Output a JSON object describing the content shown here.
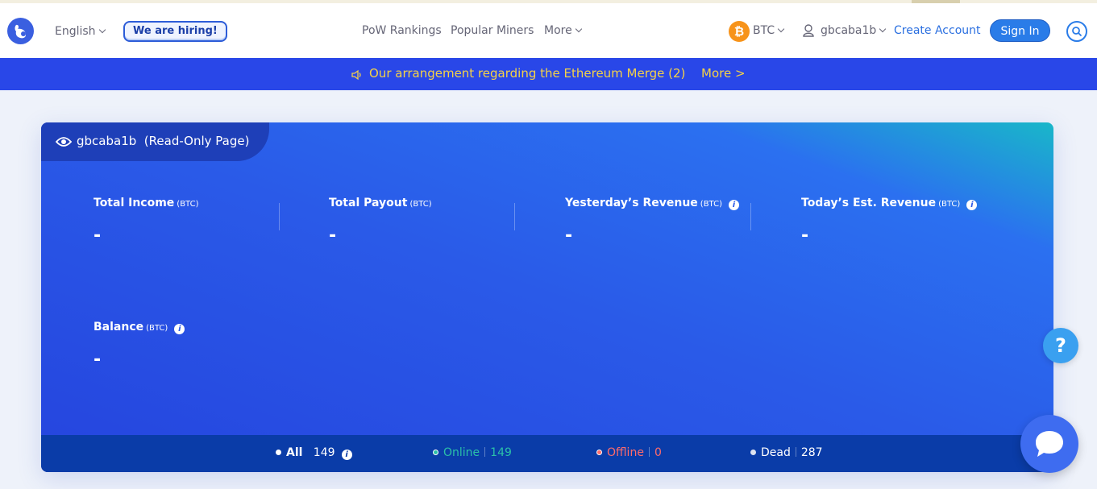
{
  "header": {
    "language": "English",
    "hiring": "We are hiring!",
    "nav": [
      "PoW Rankings",
      "Popular Miners",
      "More"
    ],
    "coin": "BTC",
    "username": "gbcaba1b",
    "create_account": "Create Account",
    "sign_in": "Sign In"
  },
  "banner": {
    "text": "Our arrangement regarding the Ethereum Merge (2)",
    "more": "More >"
  },
  "card": {
    "title": "gbcaba1b  (Read-Only Page)",
    "stats": [
      {
        "label": "Total Income",
        "unit": "(BTC)",
        "value": "-"
      },
      {
        "label": "Total Payout",
        "unit": "(BTC)",
        "value": "-"
      },
      {
        "label": "Yesterday’s Revenue",
        "unit": "(BTC)",
        "value": "-"
      },
      {
        "label": "Today’s Est. Revenue",
        "unit": "(BTC)",
        "value": "-"
      }
    ],
    "balance": {
      "label": "Balance",
      "unit": "(BTC)",
      "value": "-"
    },
    "workers": {
      "all_label": "All",
      "all_count": "149",
      "online_label": "Online",
      "online_count": "149",
      "offline_label": "Offline",
      "offline_count": "0",
      "dead_label": "Dead",
      "dead_count": "287"
    }
  },
  "widgets": {
    "help": "?"
  },
  "colors": {
    "accent": "#2a7ce8",
    "banner": "#2947e8",
    "banner_text": "#f5d247",
    "online": "#2bc0a8",
    "offline": "#ff6b6b",
    "btc": "#f7931a"
  }
}
